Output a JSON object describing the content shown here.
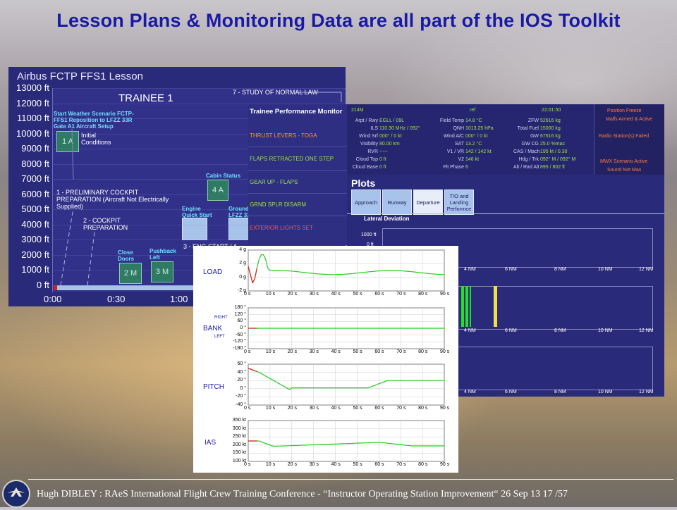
{
  "slide": {
    "title": "Lesson Plans & Monitoring Data are all part of the IOS Toolkit",
    "footer": "Hugh DIBLEY : RAeS International Flight Crew Training Conference - “Instructor Operating Station Improvement“ 26 Sep 13 17 /57"
  },
  "lesson": {
    "title": "Airbus FCTP FFS1 Lesson",
    "trainee": "TRAINEE 1",
    "study": "7 - STUDY OF NORMAL LAW",
    "y_ticks": [
      "13000 ft",
      "12000 ft",
      "11000 ft",
      "10000 ft",
      "9000 ft",
      "8000 ft",
      "7000 ft",
      "6000 ft",
      "5000 ft",
      "4000 ft",
      "3000 ft",
      "2000 ft",
      "1000 ft",
      "0 ft"
    ],
    "x_ticks": [
      "0:00",
      "0:30",
      "1:00"
    ],
    "weather_label": "Start Weather Scenario FCTP-FFS1 Reposition to LFZZ 33R Gate A1 Aircraft Setup",
    "box_1a": "1 A",
    "initial_conditions": "Initial Conditions",
    "prelim": "1 - PRELIMINARY COCKPIT PREPARATION (Aircraft Not Electrically Supplied)",
    "cockpit_prep": "2 - COCKPIT PREPARATION",
    "cabin_status": "Cabin Status",
    "box_4a": "4 A",
    "engine_quick_start": "Engine Quick Start",
    "ground_label": "Ground S LFZZ 33",
    "close_doors": "Close Doors",
    "pushback_left": "Pushback Left",
    "box_2m": "2 M",
    "box_3m": "3 M",
    "eng_start": "3 - ENG START / A"
  },
  "perf_monitor": {
    "title": "Trainee Performance Monitor",
    "items": [
      {
        "label": "THRUST LEVERS - TOGA",
        "status": "orange"
      },
      {
        "label": "FLAPS RETRACTED ONE STEP",
        "status": "green"
      },
      {
        "label": "GEAR UP - FLAPS",
        "status": "green"
      },
      {
        "label": "GRND SPLR DISARM",
        "status": "green"
      },
      {
        "label": "EXTERIOR LIGHTS SET",
        "status": "red"
      }
    ]
  },
  "status": {
    "id": "214M",
    "ref": "ref",
    "time": "22:01:50",
    "col1": [
      {
        "k": "Arpt / Rwy",
        "v": "EGLL / 09L"
      },
      {
        "k": "ILS",
        "v": "110.30 MHz / 092°"
      },
      {
        "k": "Wind Srf",
        "v": "000° / 0 kt"
      },
      {
        "k": "Visibility",
        "v": "80.00 km"
      },
      {
        "k": "RVR",
        "v": "-----"
      },
      {
        "k": "Cloud Top",
        "v": "0 ft"
      },
      {
        "k": "Cloud Base",
        "v": "0 ft"
      }
    ],
    "col2": [
      {
        "k": "Field Temp",
        "v": "14.8 °C"
      },
      {
        "k": "QNH",
        "v": "1013.25 hPa"
      },
      {
        "k": "Wind A/C",
        "v": "000° / 0 kt"
      },
      {
        "k": "SAT",
        "v": "13.2 °C"
      },
      {
        "k": "V1 / VR",
        "v": "142 / 142 kt"
      },
      {
        "k": "V2",
        "v": "146 kt"
      },
      {
        "k": "Flt Phase",
        "v": "6"
      }
    ],
    "col3": [
      {
        "k": "ZFW",
        "v": "52616 kg"
      },
      {
        "k": "Total Fuel",
        "v": "15000 kg"
      },
      {
        "k": "GW",
        "v": "67616 kg"
      },
      {
        "k": "GW CG",
        "v": "25.0 %mac"
      },
      {
        "k": "CAS / Mach",
        "v": "195 kt / 0.30"
      },
      {
        "k": "Hdg / Trk",
        "v": "092° M / 092° M"
      },
      {
        "k": "Alt / Rad Alt",
        "v": "895 / 802 ft"
      }
    ],
    "alerts": [
      "Position Freeze",
      "Malfs Armed & Active",
      "Radio Station(s) Failed",
      "MWX Scenario Active",
      "Sound Not Max"
    ]
  },
  "plots": {
    "title": "Plots",
    "tabs": [
      "Approach",
      "Runway",
      "Departure",
      "T/O and Landing Performce"
    ],
    "active_tab": "Departure",
    "lateral_title": "Lateral Deviation",
    "lat_y": [
      "1000 ft",
      "0 ft"
    ],
    "nm_ticks": [
      "4 NM",
      "6 NM",
      "8 NM",
      "10 NM",
      "12 NM"
    ],
    "colors": {
      "green": "#22e022",
      "yellow": "#f0e040"
    }
  },
  "graphs": {
    "time_ticks": [
      "0 s",
      "10 s",
      "20 s",
      "30 s",
      "40 s",
      "50 s",
      "60 s",
      "70 s",
      "80 s",
      "90 s"
    ],
    "load": {
      "name": "LOAD",
      "y": [
        "4 g",
        "2 g",
        "0 g",
        "-2 g"
      ]
    },
    "bank": {
      "name": "BANK",
      "right": "RIGHT",
      "left": "LEFT",
      "y": [
        "180 °",
        "120 °",
        "60 °",
        "0 °",
        "-60 °",
        "-120 °",
        "-180 °"
      ]
    },
    "pitch": {
      "name": "PITCH",
      "y": [
        "60 °",
        "40 °",
        "20 °",
        "0 °",
        "-20 °",
        "-40 °"
      ]
    },
    "ias": {
      "name": "IAS",
      "y": [
        "350 kt",
        "300 kt",
        "250 kt",
        "200 kt",
        "150 kt",
        "100 kt"
      ]
    }
  }
}
